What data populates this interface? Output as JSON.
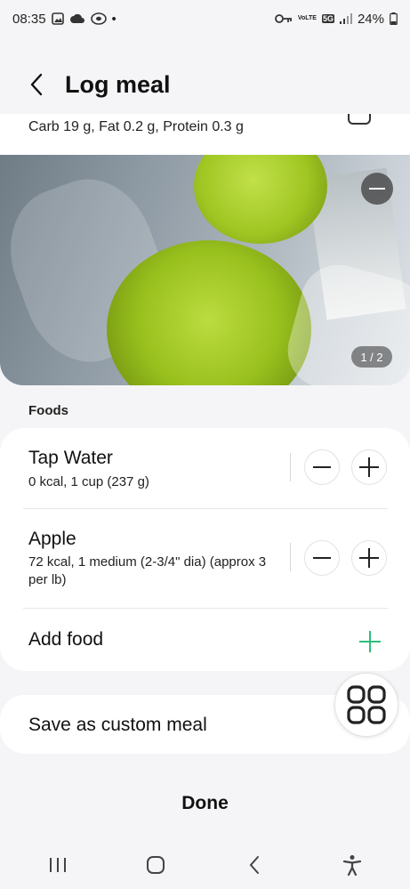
{
  "status_bar": {
    "time": "08:35",
    "dot": "•",
    "network": "5G",
    "volte": "VoLTE",
    "battery": "24%"
  },
  "header": {
    "title": "Log meal"
  },
  "summary": {
    "nutrients": "Carb 19 g, Fat 0.2 g, Protein 0.3 g"
  },
  "photo": {
    "page_indicator": "1 / 2"
  },
  "foods": {
    "section_title": "Foods",
    "items": [
      {
        "name": "Tap Water",
        "detail": "0 kcal, 1 cup (237 g)"
      },
      {
        "name": "Apple",
        "detail": "72 kcal, 1 medium (2-3/4\" dia) (approx 3 per lb)"
      }
    ],
    "add_label": "Add food"
  },
  "custom_meal": {
    "label": "Save as custom meal"
  },
  "done_label": "Done",
  "colors": {
    "accent_green": "#2bbf7a",
    "background": "#f5f5f7",
    "card": "#ffffff"
  }
}
